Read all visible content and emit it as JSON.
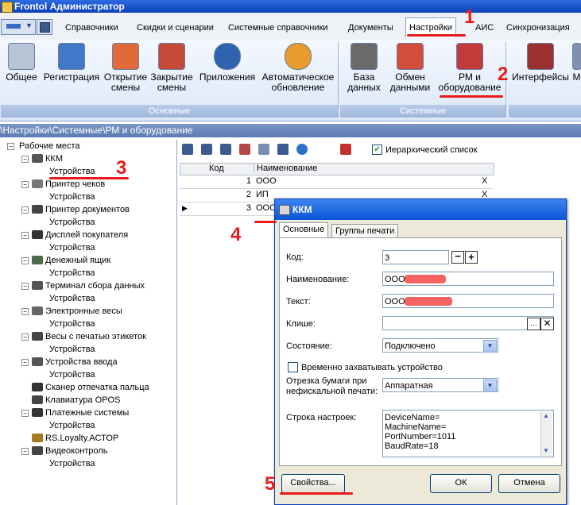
{
  "window": {
    "title": "Frontol Администратор"
  },
  "menu": {
    "tabs": [
      {
        "label": "Справочники"
      },
      {
        "label": "Скидки и сценарии"
      },
      {
        "label": "Системные справочники"
      },
      {
        "label": "Документы"
      },
      {
        "label": "Настройки"
      },
      {
        "label": "АИС"
      },
      {
        "label": "Синхронизация"
      }
    ]
  },
  "ribbon": {
    "groups": [
      {
        "caption": "Основные"
      },
      {
        "caption": "Системные"
      }
    ],
    "buttons": [
      {
        "label": "Общее",
        "icon": "general-icon"
      },
      {
        "label": "Регистрация",
        "icon": "registration-icon"
      },
      {
        "label": "Открытие смены",
        "icon": "shift-open-icon"
      },
      {
        "label": "Закрытие смены",
        "icon": "shift-close-icon"
      },
      {
        "label": "Приложения",
        "icon": "apps-icon"
      },
      {
        "label": "Автоматическое обновление",
        "icon": "update-icon"
      },
      {
        "label": "База данных",
        "icon": "database-icon"
      },
      {
        "label": "Обмен данными",
        "icon": "exchange-icon"
      },
      {
        "label": "РМ и оборудование",
        "icon": "workplace-icon"
      },
      {
        "label": "Интерфейсы",
        "icon": "interfaces-icon"
      },
      {
        "label": "М",
        "icon": "more-icon"
      }
    ]
  },
  "breadcrumb": "\\Настройки\\Системные\\РМ и оборудование",
  "tree": {
    "root": "Рабочие места",
    "items": [
      {
        "label": "ККМ",
        "child": "Устройства"
      },
      {
        "label": "Принтер чеков",
        "child": "Устройства"
      },
      {
        "label": "Принтер документов",
        "child": "Устройства"
      },
      {
        "label": "Дисплей покупателя",
        "child": "Устройства"
      },
      {
        "label": "Денежный ящик",
        "child": "Устройства"
      },
      {
        "label": "Терминал сбора данных",
        "child": "Устройства"
      },
      {
        "label": "Электронные весы",
        "child": "Устройства"
      },
      {
        "label": "Весы с печатью этикеток",
        "child": "Устройства"
      },
      {
        "label": "Устройства ввода",
        "child": "Устройства"
      },
      {
        "label": "Сканер отпечатка пальца",
        "child": ""
      },
      {
        "label": "Клавиатура OPOS",
        "child": ""
      },
      {
        "label": "Платежные системы",
        "child": "Устройства"
      },
      {
        "label": "RS.Loyalty.АСТОР",
        "child": ""
      },
      {
        "label": "Видеоконтроль",
        "child": "Устройства"
      }
    ]
  },
  "grid": {
    "hierarchical_label": "Иерархический список",
    "hierarchical_checked": true,
    "columns": {
      "code": "Код",
      "name": "Наименование"
    },
    "rows": [
      {
        "code": "1",
        "name": "ООО",
        "mark": "X"
      },
      {
        "code": "2",
        "name": "ИП",
        "mark": "X"
      },
      {
        "code": "3",
        "name": "ООО",
        "mark": ""
      }
    ]
  },
  "dialog": {
    "title": "ККМ",
    "tabs": [
      "Основные",
      "Группы печати"
    ],
    "fields": {
      "code_label": "Код:",
      "code_value": "3",
      "name_label": "Наименование:",
      "name_value": "ООО",
      "text_label": "Текст:",
      "text_value": "ООО",
      "cliche_label": "Клише:",
      "cliche_value": "",
      "state_label": "Состояние:",
      "state_value": "Подключено",
      "capture_label": "Временно захватывать устройство",
      "capture_checked": false,
      "cut_label_1": "Отрезка бумаги при",
      "cut_label_2": "нефискальной печати:",
      "cut_value": "Аппаратная",
      "settings_label": "Строка настроек:",
      "settings_lines": [
        "DeviceName=",
        "MachineName=",
        "PortNumber=1011",
        "BaudRate=18"
      ]
    },
    "buttons": {
      "properties": "Свойства...",
      "ok": "ОК",
      "cancel": "Отмена"
    }
  },
  "annotations": [
    "1",
    "2",
    "3",
    "4",
    "5"
  ],
  "colors": {
    "accent": "#0a3fb8",
    "annotation": "#e81a1a"
  }
}
